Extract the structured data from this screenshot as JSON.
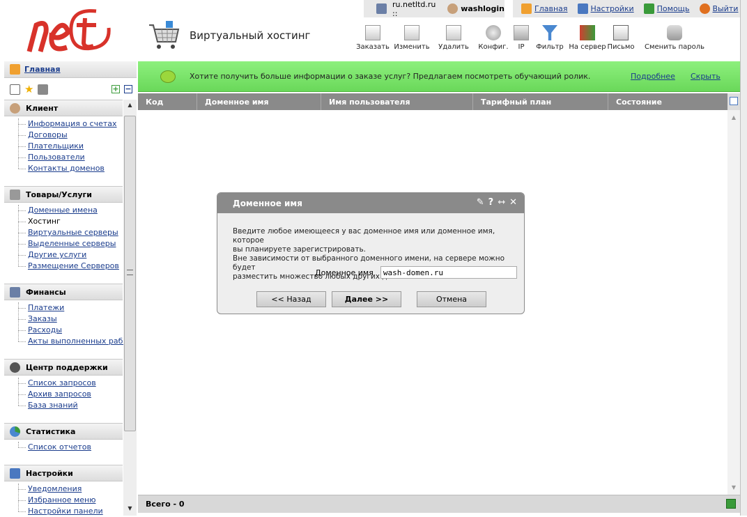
{
  "header": {
    "domain": "ru.netltd.ru ::",
    "username": "washlogin",
    "nav": [
      {
        "label": "Главная"
      },
      {
        "label": "Настройки"
      },
      {
        "label": "Помощь"
      },
      {
        "label": "Выйти"
      }
    ],
    "page_title": "Виртуальный хостинг"
  },
  "toolbar": [
    {
      "label": "Заказать",
      "icon": "order-icon"
    },
    {
      "label": "Изменить",
      "icon": "edit-icon"
    },
    {
      "label": "Удалить",
      "icon": "delete-icon"
    },
    {
      "label": "Конфиг.",
      "icon": "config-icon"
    },
    {
      "label": "IP",
      "icon": "ip-icon"
    },
    {
      "label": "Фильтр",
      "icon": "filter-icon"
    },
    {
      "label": "На сервер",
      "icon": "to-server-icon"
    },
    {
      "label": "Письмо",
      "icon": "letter-icon"
    },
    {
      "label": "Сменить пароль",
      "icon": "key-icon"
    }
  ],
  "sidebar": {
    "home": "Главная",
    "sections": [
      {
        "title": "Клиент",
        "items": [
          "Информация о счетах",
          "Договоры",
          "Плательщики",
          "Пользователи",
          "Контакты доменов"
        ]
      },
      {
        "title": "Товары/Услуги",
        "items": [
          "Доменные имена",
          "Хостинг",
          "Виртуальные серверы",
          "Выделенные серверы",
          "Другие услуги",
          "Размещение Серверов"
        ]
      },
      {
        "title": "Финансы",
        "items": [
          "Платежи",
          "Заказы",
          "Расходы",
          "Акты выполненных работ"
        ]
      },
      {
        "title": "Центр поддержки",
        "items": [
          "Список запросов",
          "Архив запросов",
          "База знаний"
        ]
      },
      {
        "title": "Статистика",
        "items": [
          "Список отчетов"
        ]
      },
      {
        "title": "Настройки",
        "items": [
          "Уведомления",
          "Избранное меню",
          "Настройки панели"
        ]
      }
    ]
  },
  "banner": {
    "text": "Хотите получить больше информации о заказе услуг? Предлагаем посмотреть обучающий ролик.",
    "more": "Подробнее",
    "hide": "Скрыть"
  },
  "table": {
    "columns": [
      "Код",
      "Доменное имя",
      "Имя пользователя",
      "Тарифный план",
      "Состояние"
    ],
    "footer": "Всего - 0"
  },
  "dialog": {
    "title": "Доменное имя",
    "body": "Введите любое имеющееся у вас доменное имя или доменное имя, которое\nвы планируете зарегистрировать.\nВне зависимости от выбранного доменного имени, на сервере можно будет\nразместить множество любых других доменов.",
    "field_label": "Доменное имя",
    "field_value": "wash-domen.ru",
    "back": "<< Назад",
    "next": "Далее >>",
    "cancel": "Отмена"
  }
}
